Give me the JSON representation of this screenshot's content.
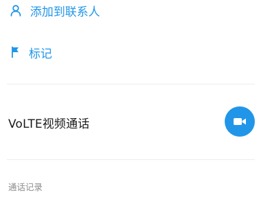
{
  "actions": {
    "add_to_contacts_label": "添加到联系人",
    "mark_label": "标记"
  },
  "volte": {
    "label": "VoLTE视频通话"
  },
  "call_log": {
    "section_title": "通话记录"
  },
  "icons": {
    "add_contact": "person-icon",
    "mark": "flag-icon",
    "video_call": "video-camera-icon"
  },
  "colors": {
    "accent": "#2196e8",
    "divider": "#ececec",
    "primary_text": "#1a1a1a",
    "secondary_text": "#8c8c8c"
  }
}
